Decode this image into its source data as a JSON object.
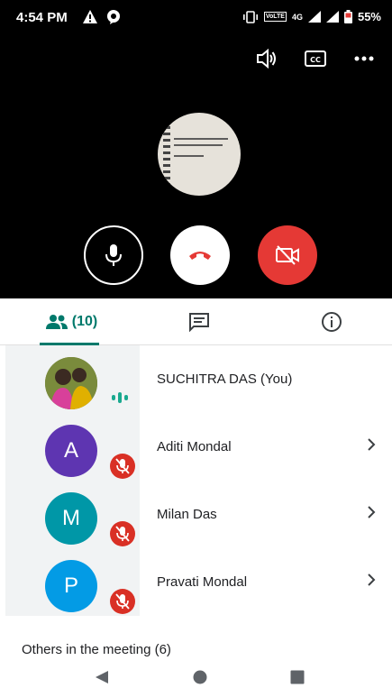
{
  "status_bar": {
    "time": "4:54 PM",
    "battery": "55%",
    "network": "4G",
    "volte": "VoLTE"
  },
  "top_actions": [
    "speaker-icon",
    "captions-icon",
    "more-icon"
  ],
  "controls": {
    "mic": "mic-icon",
    "end": "end-call-icon",
    "camera": "camera-off-icon",
    "end_color": "#e53935",
    "camera_color": "#e53935"
  },
  "tabs": {
    "people_count": "(10)",
    "accent": "#00796b"
  },
  "participants": [
    {
      "name": "SUCHITRA DAS (You)",
      "initial": "",
      "color": "",
      "muted": false,
      "speaking": true,
      "chevron": false
    },
    {
      "name": "Aditi Mondal",
      "initial": "A",
      "color": "#5e35b1",
      "muted": true,
      "speaking": false,
      "chevron": true
    },
    {
      "name": "Milan Das",
      "initial": "M",
      "color": "#0097a7",
      "muted": true,
      "speaking": false,
      "chevron": true
    },
    {
      "name": "Pravati Mondal",
      "initial": "P",
      "color": "#039be5",
      "muted": true,
      "speaking": false,
      "chevron": true
    }
  ],
  "others_label": "Others in the meeting (6)"
}
